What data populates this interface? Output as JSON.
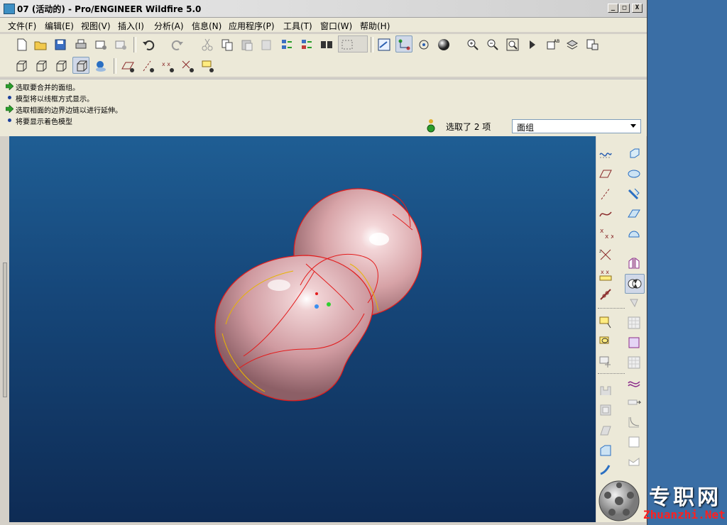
{
  "window": {
    "title": "07 (活动的) - Pro/ENGINEER Wildfire 5.0",
    "controls": [
      "_",
      "□",
      "X"
    ]
  },
  "menu": [
    {
      "label": "文件(F)"
    },
    {
      "label": "编辑(E)"
    },
    {
      "label": "视图(V)"
    },
    {
      "label": "插入(I)"
    },
    {
      "label": "分析(A)"
    },
    {
      "label": "信息(N)"
    },
    {
      "label": "应用程序(P)"
    },
    {
      "label": "工具(T)"
    },
    {
      "label": "窗口(W)"
    },
    {
      "label": "帮助(H)"
    }
  ],
  "toolbar_top": [
    {
      "name": "new-icon"
    },
    {
      "name": "open-icon"
    },
    {
      "name": "save-icon"
    },
    {
      "name": "print-icon"
    },
    {
      "name": "email-icon"
    },
    {
      "name": "email-link-icon"
    },
    {
      "name": "undo-icon"
    },
    {
      "name": "redo-icon"
    },
    {
      "name": "cut-icon"
    },
    {
      "name": "copy-icon"
    },
    {
      "name": "paste-icon"
    },
    {
      "name": "paste-special-icon"
    },
    {
      "name": "regenerate-icon"
    },
    {
      "name": "regen-manager-icon"
    },
    {
      "name": "find-icon"
    },
    {
      "name": "select-box-icon"
    },
    {
      "name": "repaint-icon"
    },
    {
      "name": "spin-center-icon"
    },
    {
      "name": "orient-mode-icon"
    },
    {
      "name": "appearance-icon"
    },
    {
      "name": "zoom-in-icon"
    },
    {
      "name": "zoom-out-icon"
    },
    {
      "name": "refit-icon"
    },
    {
      "name": "reorient-icon"
    },
    {
      "name": "saved-views-icon"
    },
    {
      "name": "layers-icon"
    },
    {
      "name": "view-manager-icon"
    }
  ],
  "toolbar_second": [
    {
      "name": "wireframe-icon"
    },
    {
      "name": "hidden-line-icon"
    },
    {
      "name": "no-hidden-icon"
    },
    {
      "name": "shading-icon"
    },
    {
      "name": "model-tree-icon"
    },
    {
      "name": "datum-plane-display-icon"
    },
    {
      "name": "datum-axis-display-icon"
    },
    {
      "name": "datum-point-display-icon"
    },
    {
      "name": "csys-display-icon"
    },
    {
      "name": "annotation-display-icon"
    }
  ],
  "messages": [
    {
      "type": "prompt",
      "text": "选取要合并的面组。"
    },
    {
      "type": "info",
      "text": "模型将以线框方式显示。"
    },
    {
      "type": "prompt",
      "text": "选取相面的边界边链以进行延伸。"
    },
    {
      "type": "info",
      "text": "将要显示着色模型"
    }
  ],
  "status": {
    "selection_count": "选取了 2 项",
    "filter": "面组"
  },
  "right_toolbar": [
    {
      "name": "sketch-icon"
    },
    {
      "name": "extend-icon"
    },
    {
      "name": "datum-plane-icon"
    },
    {
      "name": "revolve-icon"
    },
    {
      "name": "datum-axis-icon"
    },
    {
      "name": "sweep-icon"
    },
    {
      "name": "datum-curve-icon"
    },
    {
      "name": "blend-icon"
    },
    {
      "name": "datum-point-icon"
    },
    {
      "name": "boundary-blend-icon"
    },
    {
      "name": "csys-icon"
    },
    {
      "name": "mirror-icon"
    },
    {
      "name": "analysis-icon"
    },
    {
      "name": "merge-icon"
    },
    {
      "name": "reference-icon"
    },
    {
      "name": "trim-icon"
    },
    {
      "name": "annotation-icon"
    },
    {
      "name": "pattern-icon"
    },
    {
      "name": "copy-feature-icon"
    },
    {
      "name": "solidify-icon"
    },
    {
      "name": "insert-mode-icon"
    },
    {
      "name": "offset-icon"
    },
    {
      "name": "hole-icon"
    },
    {
      "name": "thicken-icon"
    },
    {
      "name": "shell-icon"
    },
    {
      "name": "rib-icon"
    },
    {
      "name": "draft-icon"
    },
    {
      "name": "round-icon"
    },
    {
      "name": "chamfer-icon"
    },
    {
      "name": "wrap-icon"
    }
  ],
  "watermark": {
    "cn": "专职网",
    "en": "Zhuanzhi.Net"
  },
  "colors": {
    "viewport_top": "#1f5e94",
    "viewport_bottom": "#0e2b54",
    "model_fill": "#d9a0a5",
    "edge_highlight": "#e31b1b",
    "ui_face": "#ece9d8"
  }
}
